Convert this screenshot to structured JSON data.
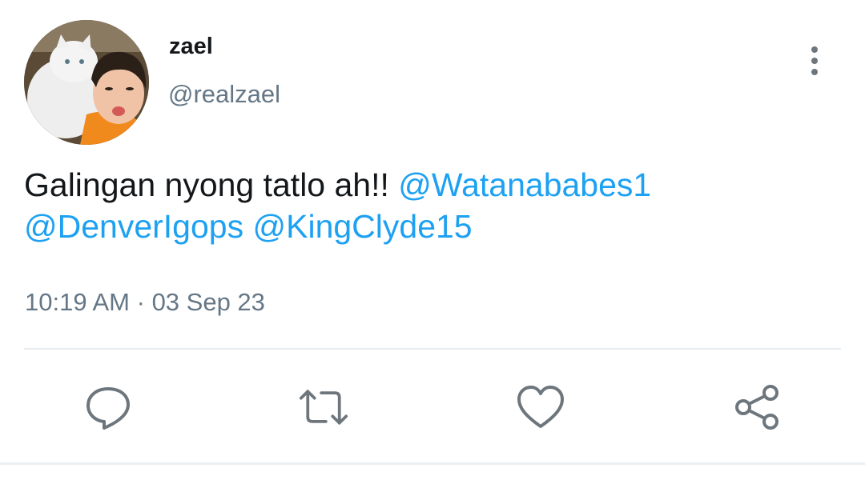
{
  "tweet": {
    "display_name": "zael",
    "handle": "@realzael",
    "text": "Galingan nyong tatlo ah!!",
    "mentions": [
      "@Watanababes1",
      "@DenverIgops",
      "@KingClyde15"
    ],
    "time": "10:19 AM",
    "separator": "·",
    "date": "03 Sep 23"
  },
  "icons": {
    "avatar": "avatar-photo",
    "more": "more-vertical-icon",
    "reply": "reply-icon",
    "retweet": "retweet-icon",
    "like": "like-icon",
    "share": "share-icon"
  },
  "colors": {
    "mention": "#1da1f2",
    "secondary_text": "#657786",
    "icon": "#6e767d",
    "divider": "#e6ecf0"
  }
}
